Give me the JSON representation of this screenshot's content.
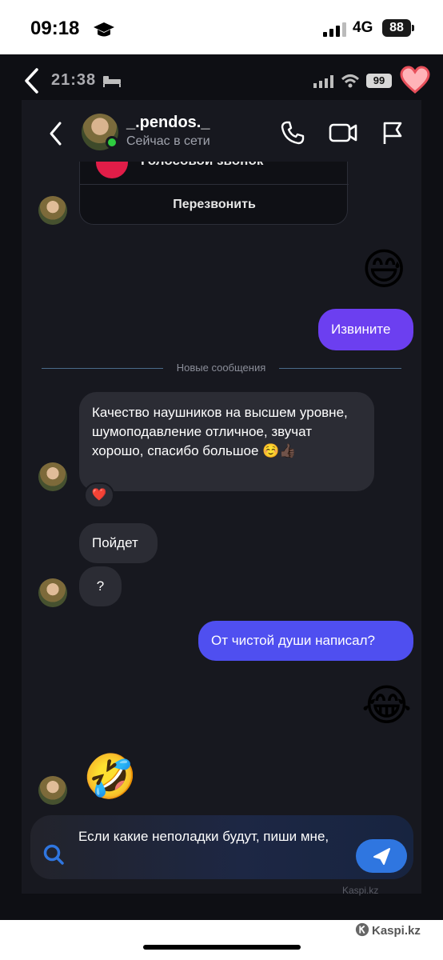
{
  "outer_status": {
    "time": "09:18",
    "network": "4G",
    "battery": "88"
  },
  "inner_status": {
    "time": "21:38",
    "battery": "99"
  },
  "chat_header": {
    "name": "_.pendos._",
    "status": "Сейчас в сети"
  },
  "call_card": {
    "type_label": "Голосовой звонок",
    "action_label": "Перезвонить"
  },
  "separator": {
    "label": "Новые сообщения"
  },
  "messages": [
    {
      "kind": "emoji",
      "from": "me",
      "text": "😅"
    },
    {
      "kind": "text",
      "from": "me",
      "text": "Извините"
    },
    {
      "kind": "text",
      "from": "them",
      "text": "Качество наушников на высшем уровне, шумоподавление отличное, звучат хорошо, спасибо большое",
      "emoji": "☺️👍🏿",
      "reaction": "❤️"
    },
    {
      "kind": "text",
      "from": "them",
      "text": "Пойдет"
    },
    {
      "kind": "text",
      "from": "them",
      "text": "?"
    },
    {
      "kind": "text",
      "from": "me",
      "text": "От чистой души написал?"
    },
    {
      "kind": "emoji",
      "from": "me",
      "text": "😂"
    },
    {
      "kind": "emoji",
      "from": "them",
      "text": "🤣"
    }
  ],
  "input": {
    "value": "Если какие неполадки будут, пиши мне,"
  },
  "watermarks": {
    "inner": "Kaspi.kz",
    "outer": "Kaspi.kz"
  },
  "colors": {
    "background": "#17181f",
    "bubble_in": "#2b2c34",
    "bubble_out": "#6c3ff0",
    "send_button": "#2f76e0",
    "online": "#2ecc40"
  },
  "icons": [
    "back-icon",
    "phone-icon",
    "video-icon",
    "flag-icon",
    "heart-icon",
    "search-icon",
    "send-icon"
  ]
}
